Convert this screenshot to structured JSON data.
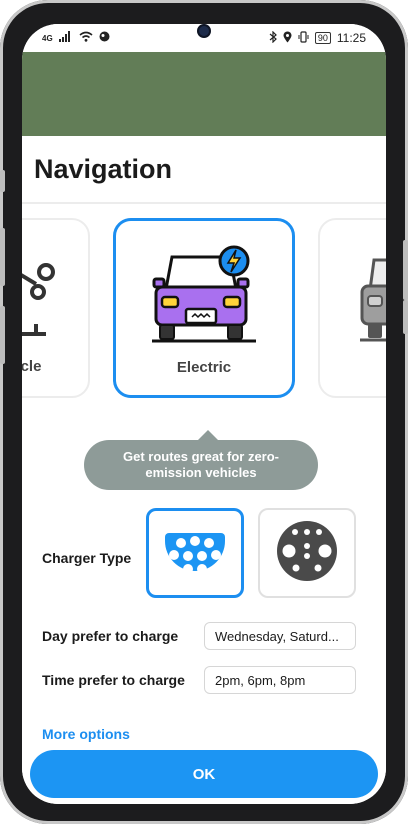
{
  "status_bar": {
    "network": "4G",
    "battery": "90",
    "time": "11:25"
  },
  "sheet": {
    "title": "Navigation"
  },
  "vehicle_types": [
    {
      "label": "cle",
      "selected": false
    },
    {
      "label": "Electric",
      "selected": true
    }
  ],
  "tooltip": {
    "text": "Get routes great for zero-emission vehicles"
  },
  "charger": {
    "label": "Charger Type",
    "options": [
      {
        "icon": "type2-connector-icon",
        "selected": true
      },
      {
        "icon": "ccs-connector-icon",
        "selected": false
      }
    ]
  },
  "day_pref": {
    "label": "Day prefer to charge",
    "value": "Wednesday, Saturd..."
  },
  "time_pref": {
    "label": "Time prefer to charge",
    "value": "2pm, 6pm, 8pm"
  },
  "more_options": "More options",
  "ok_button": "OK",
  "colors": {
    "accent": "#1c8ef0",
    "car_body": "#a970ef",
    "map": "#627d57",
    "tooltip": "#8e9b98"
  }
}
